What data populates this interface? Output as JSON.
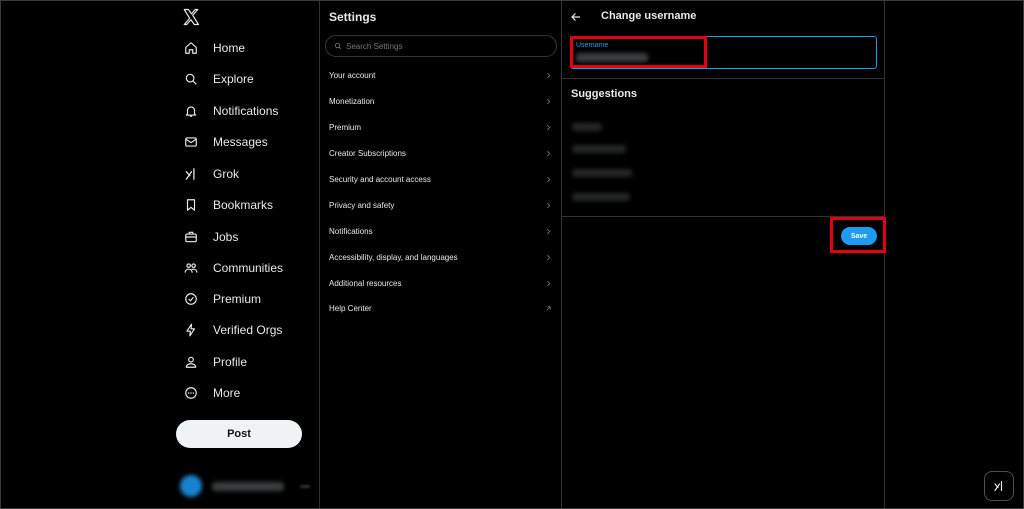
{
  "nav": {
    "items": [
      {
        "label": "Home",
        "icon": "home-icon"
      },
      {
        "label": "Explore",
        "icon": "search-icon"
      },
      {
        "label": "Notifications",
        "icon": "bell-icon"
      },
      {
        "label": "Messages",
        "icon": "envelope-icon"
      },
      {
        "label": "Grok",
        "icon": "grok-icon"
      },
      {
        "label": "Bookmarks",
        "icon": "bookmark-icon"
      },
      {
        "label": "Jobs",
        "icon": "briefcase-icon"
      },
      {
        "label": "Communities",
        "icon": "people-icon"
      },
      {
        "label": "Premium",
        "icon": "premium-badge-icon"
      },
      {
        "label": "Verified Orgs",
        "icon": "lightning-icon"
      },
      {
        "label": "Profile",
        "icon": "person-icon"
      },
      {
        "label": "More",
        "icon": "more-circle-icon"
      }
    ],
    "post_label": "Post"
  },
  "settings": {
    "title": "Settings",
    "search_placeholder": "Search Settings",
    "items": [
      {
        "label": "Your account",
        "chevron": "chevron-right-icon"
      },
      {
        "label": "Monetization",
        "chevron": "chevron-right-icon"
      },
      {
        "label": "Premium",
        "chevron": "chevron-right-icon"
      },
      {
        "label": "Creator Subscriptions",
        "chevron": "chevron-right-icon"
      },
      {
        "label": "Security and account access",
        "chevron": "chevron-right-icon"
      },
      {
        "label": "Privacy and safety",
        "chevron": "chevron-right-icon"
      },
      {
        "label": "Notifications",
        "chevron": "chevron-right-icon"
      },
      {
        "label": "Accessibility, display, and languages",
        "chevron": "chevron-right-icon"
      },
      {
        "label": "Additional resources",
        "chevron": "chevron-right-icon"
      },
      {
        "label": "Help Center",
        "chevron": "external-link-icon"
      }
    ]
  },
  "detail": {
    "title": "Change username",
    "field_label": "Username",
    "suggestions_title": "Suggestions",
    "save_label": "Save"
  },
  "colors": {
    "accent": "#1d9bf0",
    "highlight": "#e3000f",
    "background": "#000000"
  }
}
